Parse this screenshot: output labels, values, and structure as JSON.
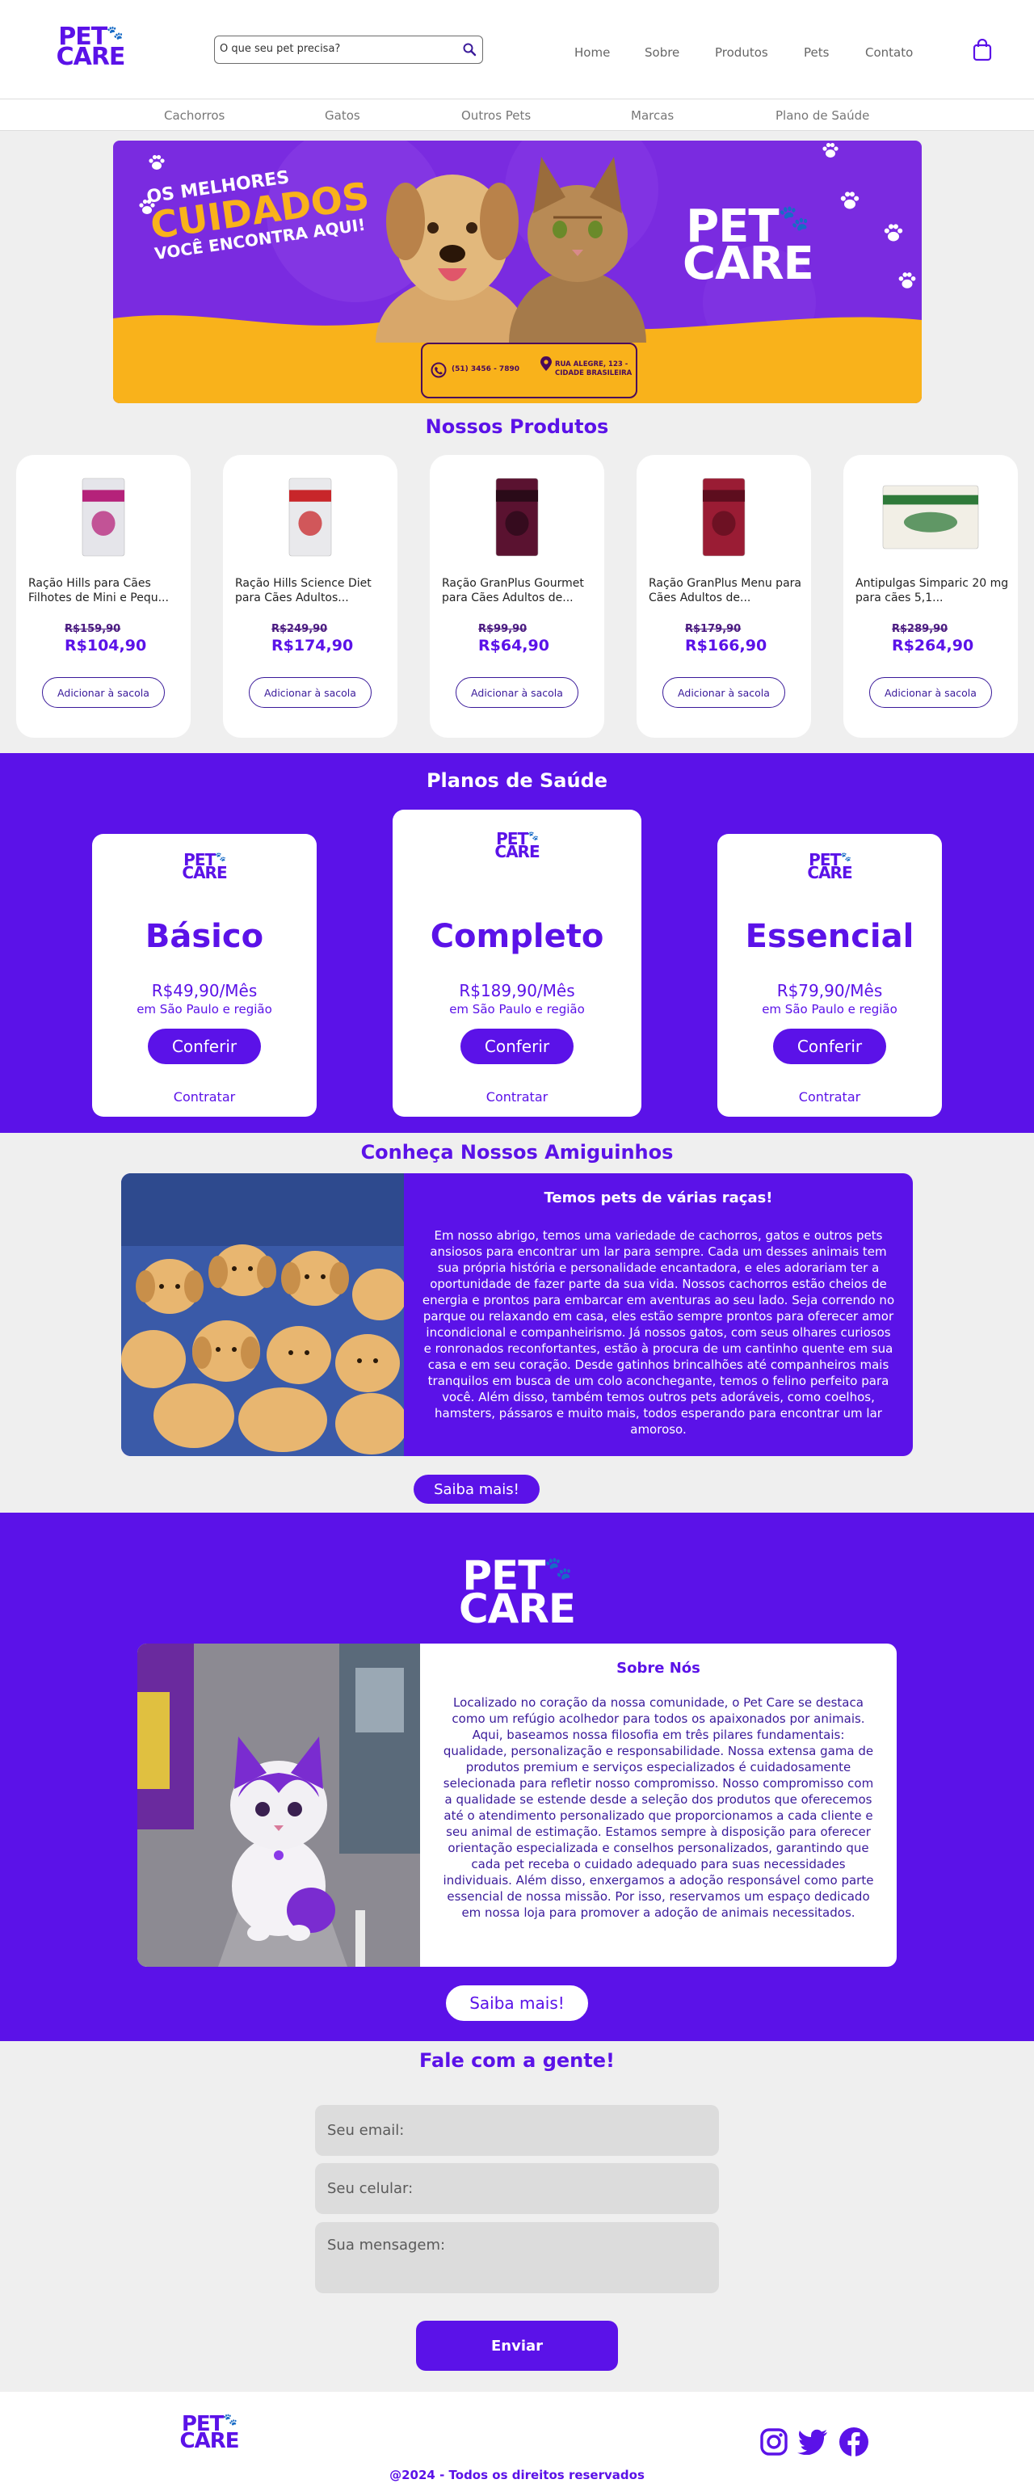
{
  "header": {
    "logo_line1": "PET",
    "logo_line2": "CARE",
    "search_placeholder": "O que seu pet precisa?",
    "nav": [
      "Home",
      "Sobre",
      "Produtos",
      "Pets",
      "Contato"
    ]
  },
  "categories": [
    "Cachorros",
    "Gatos",
    "Outros Pets",
    "Marcas",
    "Plano de Saúde"
  ],
  "banner": {
    "headline_top": "OS MELHORES",
    "headline_main": "CUIDADOS",
    "headline_bottom": "VOCÊ ENCONTRA AQUI!",
    "phone": "(51) 3456 - 7890",
    "address_line1": "RUA ALEGRE, 123 -",
    "address_line2": "CIDADE BRASILEIRA",
    "logo_line1": "PET",
    "logo_line2": "CARE"
  },
  "products": {
    "title": "Nossos Produtos",
    "items": [
      {
        "name": "Ração Hills para Cães Filhotes de Mini e Pequ...",
        "old": "R$159,90",
        "price": "R$104,90",
        "button": "Adicionar à sacola",
        "pack_color": "#e5e5ea",
        "accent": "#b5227a"
      },
      {
        "name": "Ração Hills Science Diet para Cães Adultos...",
        "old": "R$249,90",
        "price": "R$174,90",
        "button": "Adicionar à sacola",
        "pack_color": "#e9e9ec",
        "accent": "#c8262a"
      },
      {
        "name": "Ração GranPlus Gourmet para Cães Adultos de...",
        "old": "R$99,90",
        "price": "R$64,90",
        "button": "Adicionar à sacola",
        "pack_color": "#5a1230",
        "accent": "#2a0a18"
      },
      {
        "name": "Ração GranPlus Menu para Cães Adultos de...",
        "old": "R$179,90",
        "price": "R$166,90",
        "button": "Adicionar à sacola",
        "pack_color": "#9a1c34",
        "accent": "#5d0d1e"
      },
      {
        "name": "Antipulgas Simparic 20 mg para cães 5,1...",
        "old": "R$289,90",
        "price": "R$264,90",
        "button": "Adicionar à sacola",
        "pack_color": "#f2efe6",
        "accent": "#2f7a3a"
      }
    ]
  },
  "plans": {
    "title": "Planos de Saúde",
    "items": [
      {
        "name": "Básico",
        "price": "R$49,90/Mês",
        "region": "em São Paulo e região",
        "button": "Conferir",
        "link": "Contratar"
      },
      {
        "name": "Completo",
        "price": "R$189,90/Mês",
        "region": "em São Paulo e região",
        "button": "Conferir",
        "link": "Contratar"
      },
      {
        "name": "Essencial",
        "price": "R$79,90/Mês",
        "region": "em São Paulo e região",
        "button": "Conferir",
        "link": "Contratar"
      }
    ]
  },
  "pets": {
    "title": "Conheça Nossos Amiguinhos",
    "card_title": "Temos pets de várias raças!",
    "card_text": "Em nosso abrigo, temos uma variedade de cachorros, gatos e outros pets ansiosos para encontrar um lar para sempre. Cada um desses animais tem sua própria história e personalidade encantadora, e eles adorariam ter a oportunidade de fazer parte da sua vida. Nossos cachorros estão cheios de energia e prontos para embarcar em aventuras ao seu lado. Seja correndo no parque ou relaxando em casa, eles estão sempre prontos para oferecer amor incondicional e companheirismo. Já nossos gatos, com seus olhares curiosos e ronronados reconfortantes, estão à procura de um cantinho quente em sua casa e em seu coração. Desde gatinhos brincalhões até companheiros mais tranquilos em busca de um colo aconchegante, temos o felino perfeito para você. Além disso, também temos outros pets adoráveis, como coelhos, hamsters, pássaros e muito mais, todos esperando para encontrar um lar amoroso.",
    "button": "Saiba mais!"
  },
  "about": {
    "logo_line1": "PET",
    "logo_line2": "CARE",
    "card_title": "Sobre Nós",
    "card_text": "Localizado no coração da nossa comunidade, o Pet Care se destaca como um refúgio acolhedor para todos os apaixonados por animais. Aqui, baseamos nossa filosofia em três pilares fundamentais: qualidade, personalização e responsabilidade. Nossa extensa gama de produtos premium e serviços especializados é cuidadosamente selecionada para refletir nosso compromisso. Nosso compromisso com a qualidade se estende desde a seleção dos produtos que oferecemos até o atendimento personalizado que proporcionamos a cada cliente e seu animal de estimação. Estamos sempre à disposição para oferecer orientação especializada e conselhos personalizados, garantindo que cada pet receba o cuidado adequado para suas necessidades individuais. Além disso, enxergamos a adoção responsável como parte essencial de nossa missão. Por isso, reservamos um espaço dedicado em nossa loja para promover a adoção de animais necessitados.",
    "button": "Saiba mais!"
  },
  "contact": {
    "title": "Fale com a gente!",
    "email_placeholder": "Seu email:",
    "phone_placeholder": "Seu celular:",
    "message_placeholder": "Sua mensagem:",
    "button": "Enviar"
  },
  "footer": {
    "logo_line1": "PET",
    "logo_line2": "CARE",
    "copyright": "@2024 - Todos os direitos reservados",
    "social": [
      "instagram-icon",
      "twitter-icon",
      "facebook-icon"
    ]
  },
  "colors": {
    "brand": "#5b12e8",
    "banner_yellow": "#f9b21b",
    "paw_red": "#e0283a"
  }
}
